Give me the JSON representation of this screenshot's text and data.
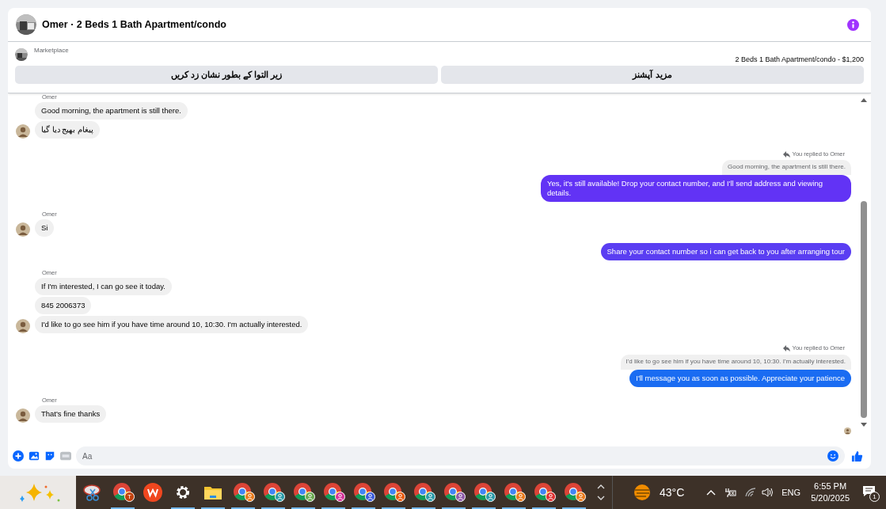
{
  "header": {
    "title": "Omer · 2 Beds 1 Bath Apartment/condo"
  },
  "listing": {
    "source": "Marketplace",
    "summary": "2 Beds 1 Bath Apartment/condo - $1,200",
    "buttons": [
      "مزید آپشنز",
      "زیر التوا کے بطور نشان زد کریں"
    ]
  },
  "groups": [
    {
      "kind": "incoming",
      "sender": "Omer",
      "messages": [
        {
          "text": "Good morning, the apartment is still there."
        },
        {
          "text": "پیغام بھیج دیا گیا"
        }
      ]
    },
    {
      "kind": "outgoing",
      "reply_note": "You replied to Omer",
      "quoted": "Good morning, the apartment is still there.",
      "messages": [
        {
          "text": "Yes, it's still available! Drop your contact number, and I'll send address and viewing details.",
          "color": "#6233f5"
        }
      ]
    },
    {
      "kind": "incoming",
      "sender": "Omer",
      "messages": [
        {
          "text": "Si"
        }
      ]
    },
    {
      "kind": "outgoing",
      "messages": [
        {
          "text": "Share your contact number so i can get back to you after arranging tour",
          "color": "#5a3ef2"
        }
      ]
    },
    {
      "kind": "incoming",
      "sender": "Omer",
      "messages": [
        {
          "text": "If I'm interested, I can go see it today."
        },
        {
          "text": "845 2006373"
        },
        {
          "text": "I'd like to go see him if you have time around 10, 10:30. I'm actually interested."
        }
      ]
    },
    {
      "kind": "outgoing",
      "reply_note": "You replied to Omer",
      "quoted": "I'd like to go see him if you have time around 10, 10:30. I'm actually interested.",
      "messages": [
        {
          "text": "I'll message you as soon as possible. Appreciate your patience",
          "color": "#1a6cf2"
        }
      ]
    },
    {
      "kind": "incoming",
      "sender": "Omer",
      "messages": [
        {
          "text": "That's fine thanks"
        }
      ]
    }
  ],
  "composer": {
    "placeholder": "Aa"
  },
  "taskbar": {
    "apps": [
      {
        "kind": "snip",
        "running": false
      },
      {
        "kind": "chrome",
        "badge": "T",
        "color": "#c2410c",
        "running": true
      },
      {
        "kind": "wps",
        "running": false
      },
      {
        "kind": "settings",
        "running": true
      },
      {
        "kind": "folder",
        "running": true
      },
      {
        "kind": "chrome",
        "color": "#ea7a1a",
        "running": true
      },
      {
        "kind": "chrome",
        "color": "#2a9aa8",
        "running": true
      },
      {
        "kind": "chrome",
        "color": "#6aa84f",
        "running": true
      },
      {
        "kind": "chrome",
        "color": "#d6339a",
        "running": true
      },
      {
        "kind": "chrome",
        "color": "#3b5bdb",
        "running": true
      },
      {
        "kind": "chrome",
        "color": "#e8590c",
        "running": true
      },
      {
        "kind": "chrome",
        "color": "#2a9aa8",
        "running": true
      },
      {
        "kind": "chrome",
        "color": "#8e5aa8",
        "running": true
      },
      {
        "kind": "chrome",
        "color": "#2a9aa8",
        "running": true
      },
      {
        "kind": "chrome",
        "color": "#ea7a1a",
        "running": true
      },
      {
        "kind": "chrome",
        "color": "#e03131",
        "running": true
      },
      {
        "kind": "chrome",
        "color": "#ea7a1a",
        "running": true
      }
    ],
    "temperature": "43°C",
    "language": "ENG",
    "time": "6:55 PM",
    "date": "5/20/2025",
    "notifications": "1"
  }
}
